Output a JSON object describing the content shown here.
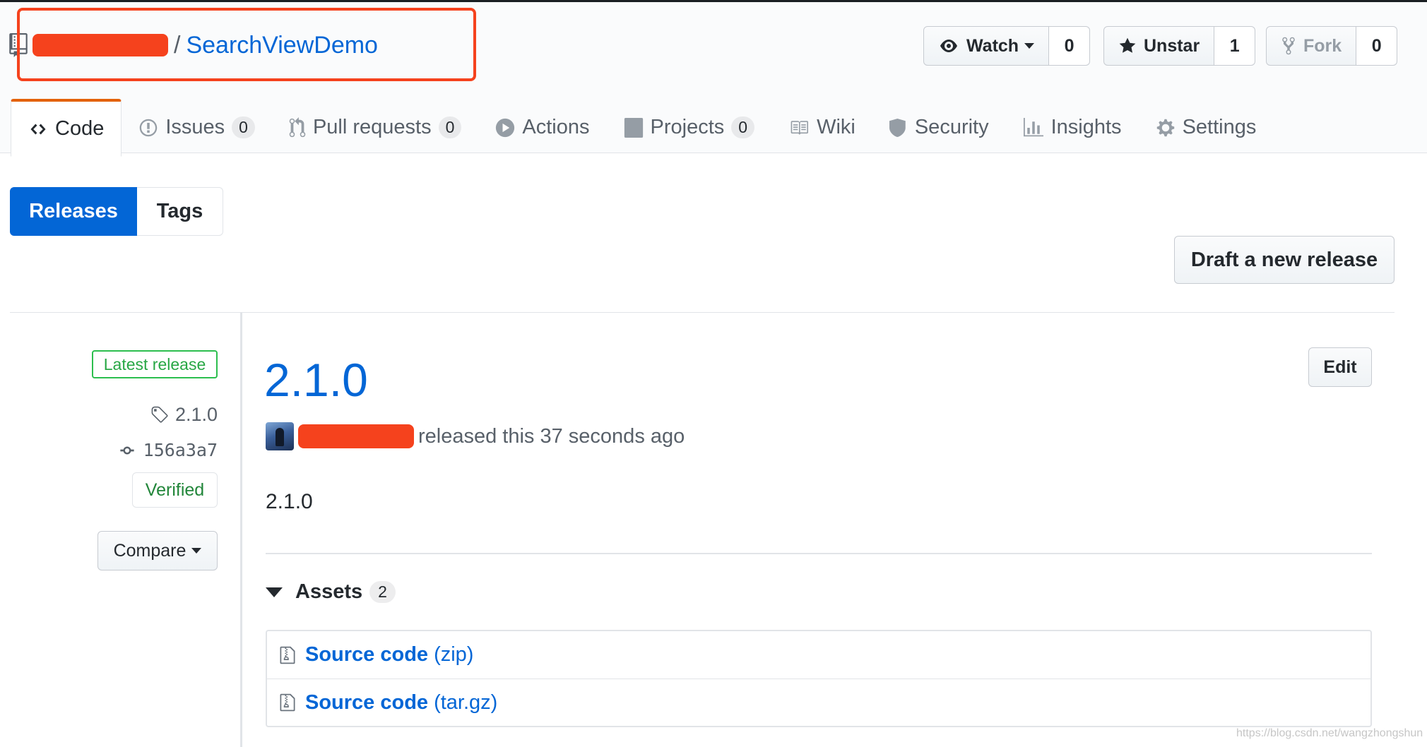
{
  "repo": {
    "separator": "/",
    "name": "SearchViewDemo"
  },
  "actions": {
    "watch_label": "Watch",
    "watch_count": "0",
    "star_label": "Unstar",
    "star_count": "1",
    "fork_label": "Fork",
    "fork_count": "0"
  },
  "tabs": [
    {
      "label": "Code",
      "icon": "code-icon"
    },
    {
      "label": "Issues",
      "count": "0",
      "icon": "issue-icon"
    },
    {
      "label": "Pull requests",
      "count": "0",
      "icon": "pull-request-icon"
    },
    {
      "label": "Actions",
      "icon": "play-icon"
    },
    {
      "label": "Projects",
      "count": "0",
      "icon": "project-icon"
    },
    {
      "label": "Wiki",
      "icon": "book-icon"
    },
    {
      "label": "Security",
      "icon": "shield-icon"
    },
    {
      "label": "Insights",
      "icon": "graph-icon"
    },
    {
      "label": "Settings",
      "icon": "gear-icon"
    }
  ],
  "subnav": {
    "releases": "Releases",
    "tags": "Tags"
  },
  "draft_button": "Draft a new release",
  "release": {
    "latest_label": "Latest release",
    "tag": "2.1.0",
    "commit": "156a3a7",
    "verified": "Verified",
    "compare": "Compare",
    "title": "2.1.0",
    "edit": "Edit",
    "byline": "released this 37 seconds ago",
    "body": "2.1.0",
    "assets_label": "Assets",
    "assets_count": "2",
    "assets": [
      {
        "name": "Source code",
        "ext": "(zip)"
      },
      {
        "name": "Source code",
        "ext": "(tar.gz)"
      }
    ]
  },
  "watermark": "https://blog.csdn.net/wangzhongshun",
  "colors": {
    "link": "#0366d6",
    "highlight": "#f5421d",
    "tab_accent": "#e36209",
    "verified_green": "#22863a"
  }
}
